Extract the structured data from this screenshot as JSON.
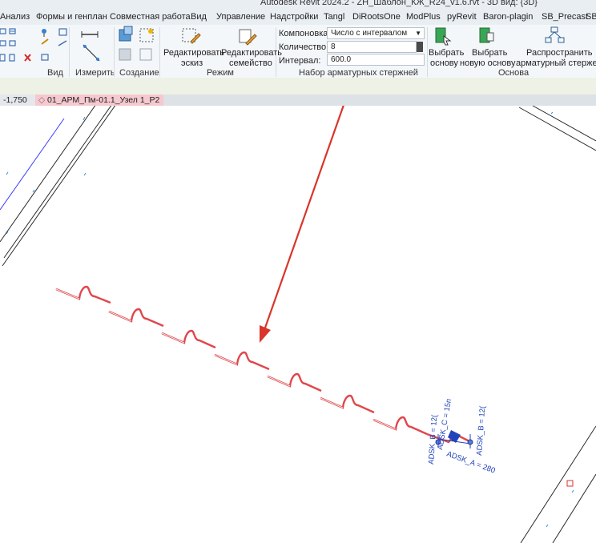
{
  "app": {
    "title": "Autodesk Revit 2024.2 - ZH_Шаблон_КЖ_R24_v1.6.rvt - 3D вид: {3D}"
  },
  "ribbon_tabs": [
    {
      "label": "Анализ"
    },
    {
      "label": "Формы и генплан"
    },
    {
      "label": "Совместная работа"
    },
    {
      "label": "Вид"
    },
    {
      "label": "Управление"
    },
    {
      "label": "Надстройки"
    },
    {
      "label": "Tangl"
    },
    {
      "label": "DiRootsOne"
    },
    {
      "label": "ModPlus"
    },
    {
      "label": "pyRevit"
    },
    {
      "label": "Baron-plagin"
    },
    {
      "label": "SB_Precast"
    },
    {
      "label": "SB"
    }
  ],
  "panels": {
    "view": {
      "label": "Вид"
    },
    "measure": {
      "label": "Измерить"
    },
    "create": {
      "label": "Создание"
    },
    "mode": {
      "label": "Режим",
      "edit_sketch_line1": "Редактировать",
      "edit_sketch_line2": "эскиз",
      "edit_family_line1": "Редактировать",
      "edit_family_line2": "семейство"
    },
    "rebar_set": {
      "label": "Набор арматурных стержней",
      "layout_label": "Компоновка:",
      "layout_value": "Число с интервалом",
      "quantity_label": "Количество:",
      "quantity_value": "8",
      "interval_label": "Интервал:",
      "interval_value": "600.0"
    },
    "host": {
      "label": "Основа",
      "pick_host_line1": "Выбрать",
      "pick_host_line2": "основу",
      "pick_new_host_line1": "Выбрать",
      "pick_new_host_line2": "новую основу",
      "propagate_line1": "Распространить",
      "propagate_line2": "арматурный стержень"
    }
  },
  "view_tabs": [
    {
      "label": "-1,750"
    },
    {
      "label": "01_АРМ_Пм-01.1_Узел 1_Р2"
    }
  ],
  "annotations": {
    "c": "ADSK_C = 15п",
    "a": "ADSK_A = 280",
    "b": "ADSK_B = 12(",
    "b2": "ADSK_B = 12("
  },
  "colors": {
    "rebar": "#e0474c",
    "arrow": "#d9352a",
    "annotation": "#2244bb",
    "active_tab": "#f5c9cf"
  }
}
